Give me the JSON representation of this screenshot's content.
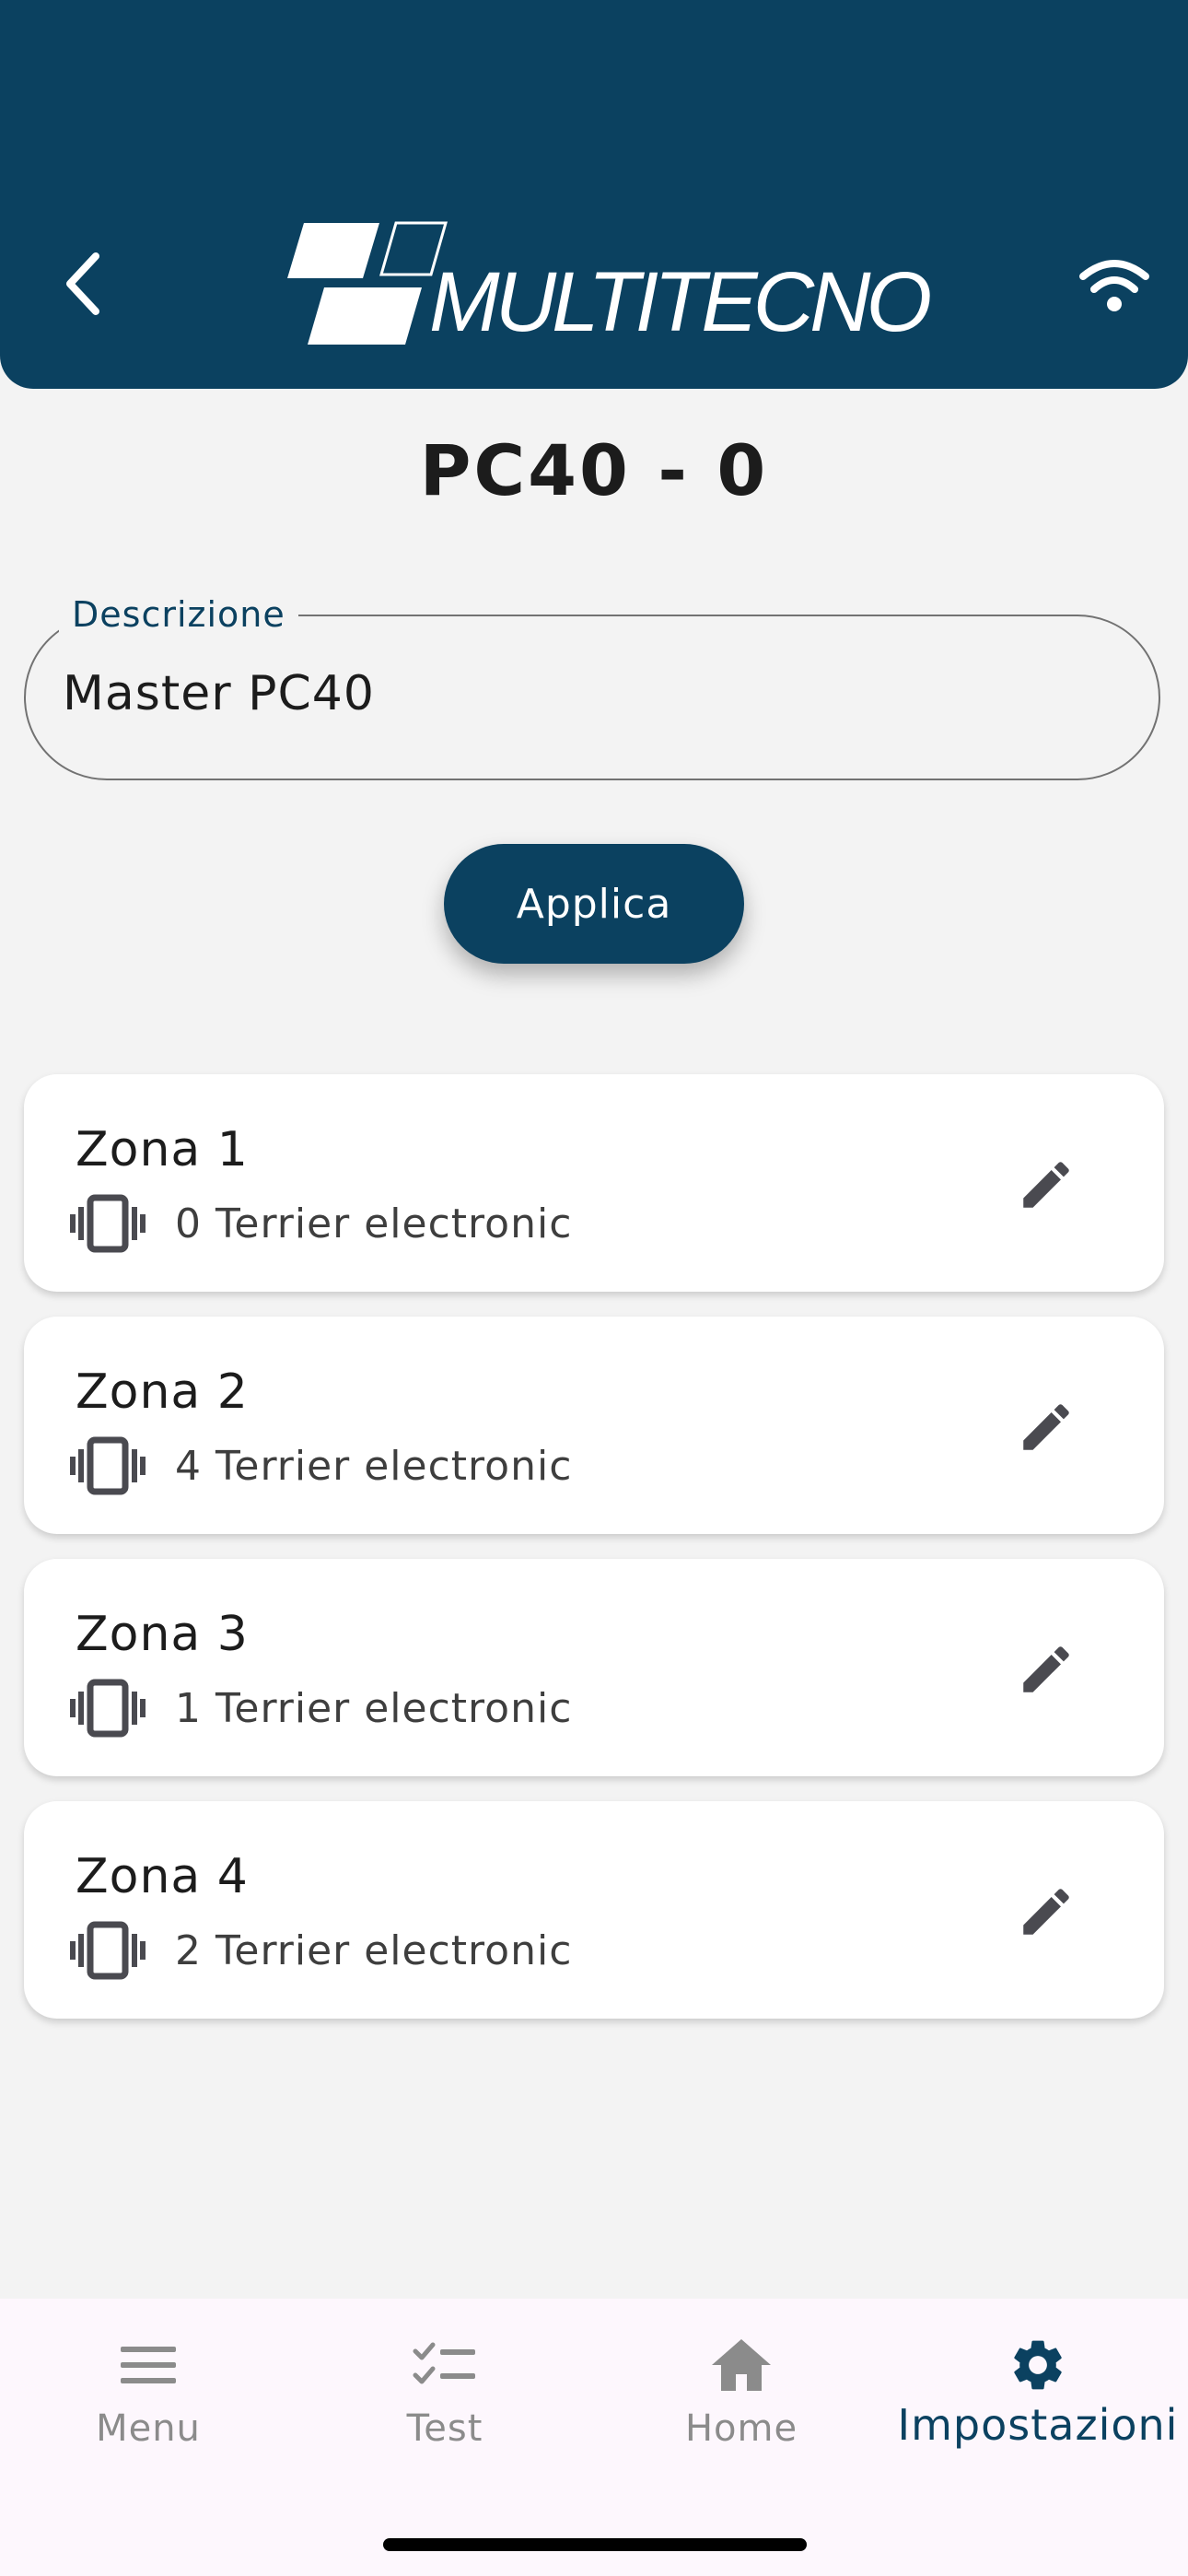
{
  "header": {
    "brand": "MULTITECNO",
    "back_icon": "chevron-left-icon",
    "wifi_icon": "wifi-icon",
    "background": "#0b4160"
  },
  "device": {
    "title": "PC40 - 0"
  },
  "description_field": {
    "label": "Descrizione",
    "value": "Master PC40"
  },
  "apply_button": {
    "label": "Applica"
  },
  "zones": [
    {
      "name": "Zona 1",
      "count": "0 Terrier electronic",
      "icon": "vibration-icon",
      "action_icon": "edit-icon"
    },
    {
      "name": "Zona 2",
      "count": "4 Terrier electronic",
      "icon": "vibration-icon",
      "action_icon": "edit-icon"
    },
    {
      "name": "Zona 3",
      "count": "1 Terrier electronic",
      "icon": "vibration-icon",
      "action_icon": "edit-icon"
    },
    {
      "name": "Zona 4",
      "count": "2 Terrier electronic",
      "icon": "vibration-icon",
      "action_icon": "edit-icon"
    }
  ],
  "bottom_nav": {
    "items": [
      {
        "label": "Menu",
        "icon": "menu-icon"
      },
      {
        "label": "Test",
        "icon": "checklist-icon"
      },
      {
        "label": "Home",
        "icon": "home-icon"
      },
      {
        "label": "Impostazioni",
        "icon": "gear-icon",
        "active": true
      }
    ],
    "active_color": "#0b4160",
    "inactive_color": "#8b8b8b"
  }
}
